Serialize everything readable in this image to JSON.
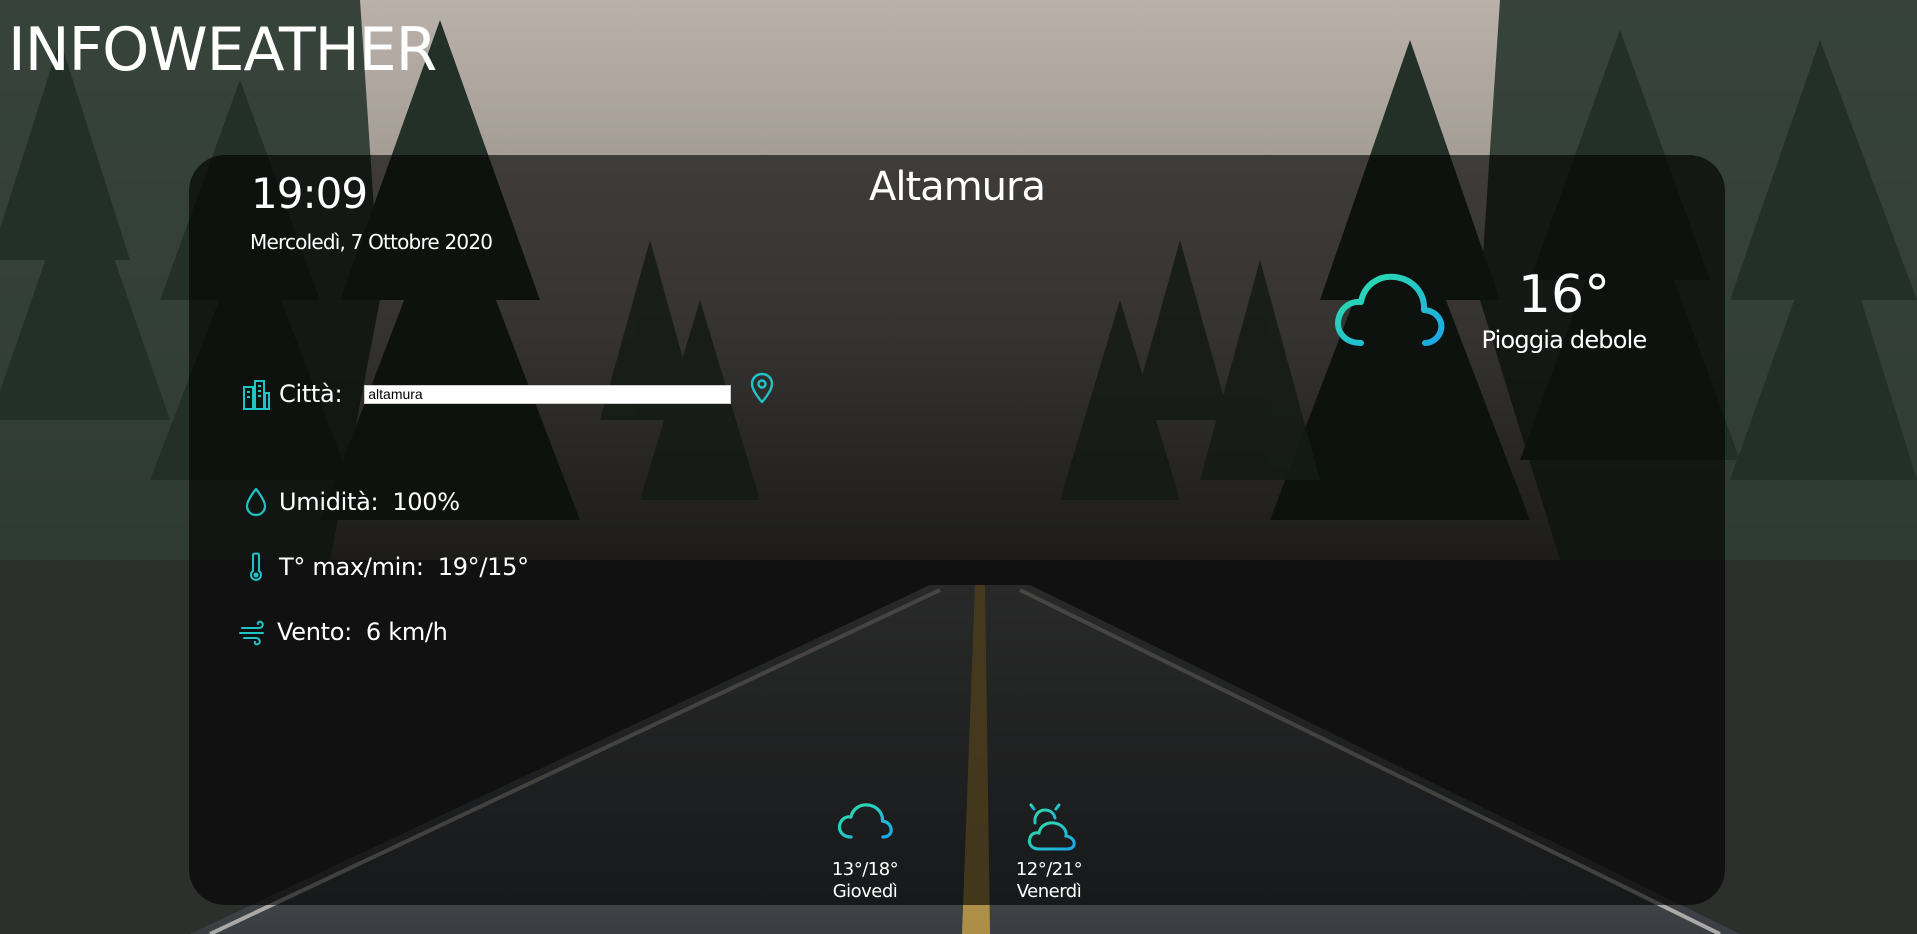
{
  "app": {
    "title": "INFOWEATHER"
  },
  "current": {
    "time": "19:09",
    "date": "Mercoledì, 7 Ottobre 2020",
    "city": "Altamura",
    "temperature": "16°",
    "description": "Pioggia debole",
    "icon": "rain-cloud-icon"
  },
  "search": {
    "label": "Città:",
    "value": "altamura",
    "icon": "city-buildings-icon",
    "locate_icon": "location-pin-icon"
  },
  "details": {
    "humidity_label": "Umidità:",
    "humidity_value": "100%",
    "temp_label": "T° max/min:",
    "temp_value": "19°/15°",
    "wind_label": "Vento:",
    "wind_value": "6 km/h"
  },
  "forecast": [
    {
      "temps": "13°/18°",
      "day": "Giovedì",
      "icon": "rain-cloud-icon"
    },
    {
      "temps": "12°/21°",
      "day": "Venerdì",
      "icon": "partly-cloudy-sun-icon"
    }
  ],
  "colors": {
    "accent_start": "#2fe2a8",
    "accent_end": "#1aa7e8",
    "card_background": "rgba(0,0,0,0.62)",
    "text": "#ffffff"
  }
}
